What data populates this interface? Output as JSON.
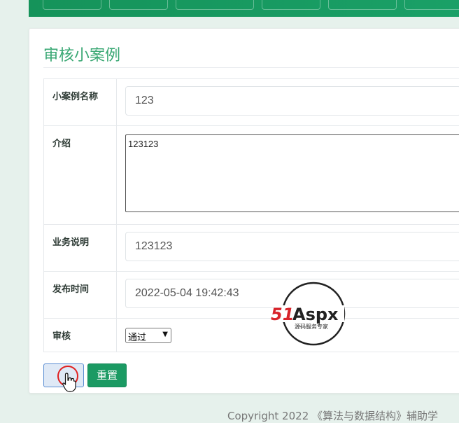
{
  "page": {
    "title": "审核小案例"
  },
  "form": {
    "name_label": "小案例名称",
    "name_value": "123",
    "intro_label": "介绍",
    "intro_value": "123123",
    "business_label": "业务说明",
    "business_value": "123123",
    "publish_label": "发布时间",
    "publish_value": "2022-05-04 19:42:43",
    "audit_label": "审核",
    "audit_selected": "通过"
  },
  "buttons": {
    "submit_label": "",
    "reset_label": "重置"
  },
  "footer": {
    "copyright": "Copyright 2022 《算法与数据结构》辅助学"
  },
  "watermark": {
    "brand": "51Aspx",
    "tagline": "源码服务专家"
  },
  "colors": {
    "primary_green": "#1b9a63",
    "title_green": "#3aa874",
    "background": "#e6f1ec"
  },
  "icons": {
    "cursor": "hand-pointer-icon",
    "chevron": "chevron-down-icon"
  }
}
